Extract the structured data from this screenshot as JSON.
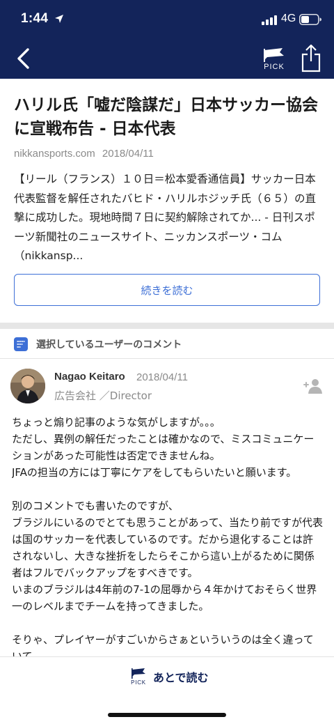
{
  "status_bar": {
    "time": "1:44",
    "network": "4G"
  },
  "nav": {
    "pick_label": "PICK"
  },
  "article": {
    "title": "ハリル氏「嘘だ陰謀だ」日本サッカー協会に宣戦布告 - 日本代表",
    "source": "nikkansports.com",
    "date": "2018/04/11",
    "summary": "【リール（フランス）１０日＝松本愛香通信員】サッカー日本代表監督を解任されたバヒド・ハリルホジッチ氏（６５）の直撃に成功した。現地時間７日に契約解除されてか... - 日刊スポーツ新聞社のニュースサイト、ニッカンスポーツ・コム（nikkansp...",
    "read_more_label": "続きを読む"
  },
  "comments": {
    "section_title": "選択しているユーザーのコメント",
    "items": [
      {
        "user_name": "Nagao Keitaro",
        "date": "2018/04/11",
        "user_title": "広告会社 ／Director",
        "body": "ちょっと煽り記事のような気がしますが。。。\nただし、異例の解任だったことは確かなので、ミスコミュニケーションがあった可能性は否定できませんね。\nJFAの担当の方には丁寧にケアをしてもらいたいと願います。\n\n別のコメントでも書いたのですが、\nブラジルにいるのでとても思うことがあって、当たり前ですが代表は国のサッカーを代表しているのです。だから退化することは許されないし、大きな挫折をしたらそこから這い上がるために関係者はフルでバックアップをすべきです。\nいまのブラジルは4年前の7-1の屈辱から４年かけておそらく世界一のレベルまでチームを持ってきました。\n\nそりゃ、プレイヤーがすごいからさぁといういうのは全く違っていて、"
      }
    ]
  },
  "bottom_bar": {
    "later_label": "あとで読む",
    "pick_label": "PICK"
  },
  "colors": {
    "header_bg": "#13245a",
    "accent": "#3d6fd6"
  },
  "icons": {
    "back": "chevron-left-icon",
    "pick": "pick-flag-icon",
    "share": "share-icon",
    "comments": "comment-bubble-icon",
    "follow": "add-user-icon",
    "location": "location-arrow-icon"
  }
}
